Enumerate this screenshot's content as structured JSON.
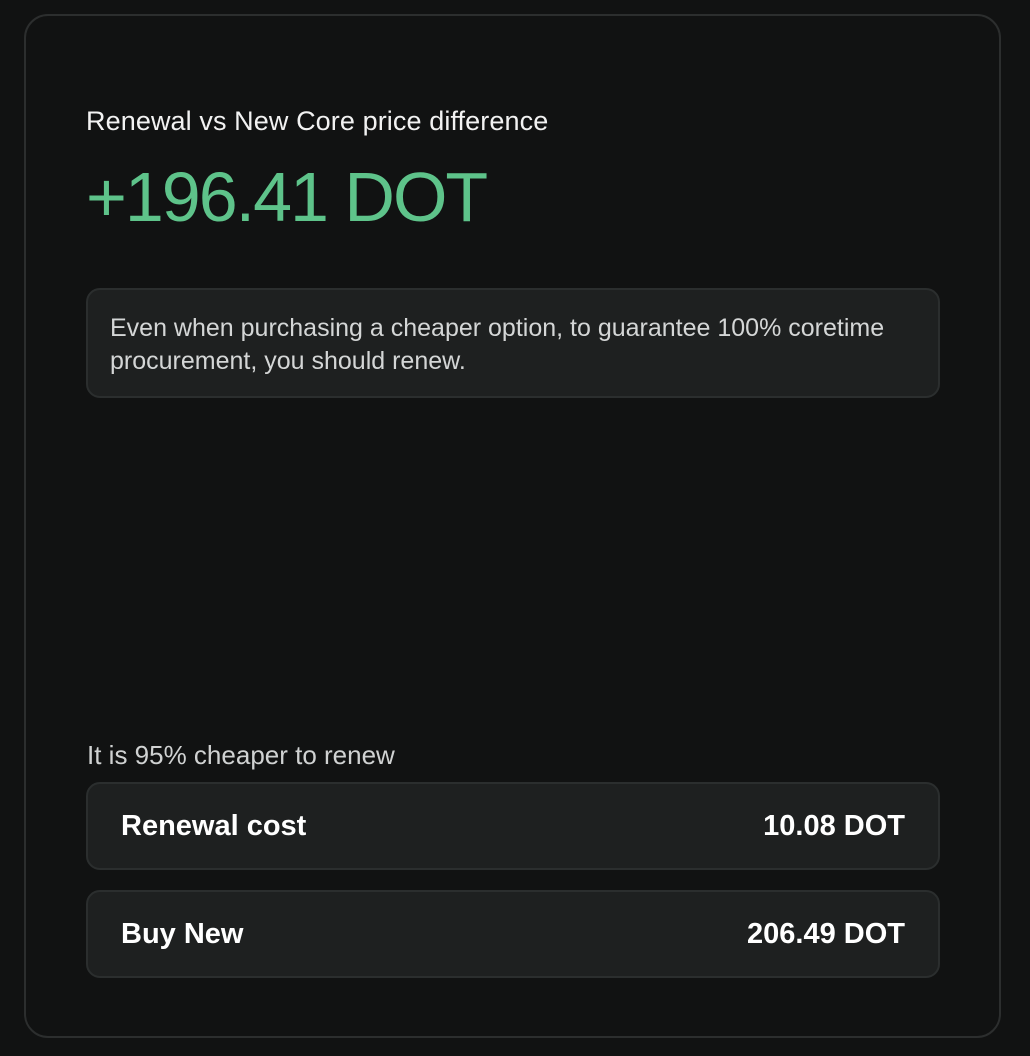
{
  "card": {
    "title": "Renewal vs New Core price difference",
    "difference": "+196.41 DOT",
    "note": "Even when purchasing a cheaper option, to guarantee 100% coretime procurement, you should renew.",
    "summary": "It is 95% cheaper to renew",
    "rows": [
      {
        "label": "Renewal cost",
        "value": "10.08 DOT"
      },
      {
        "label": "Buy New",
        "value": "206.49 DOT"
      }
    ]
  },
  "colors": {
    "background": "#111212",
    "panel": "#1e2020",
    "positive": "#5ec38a"
  }
}
